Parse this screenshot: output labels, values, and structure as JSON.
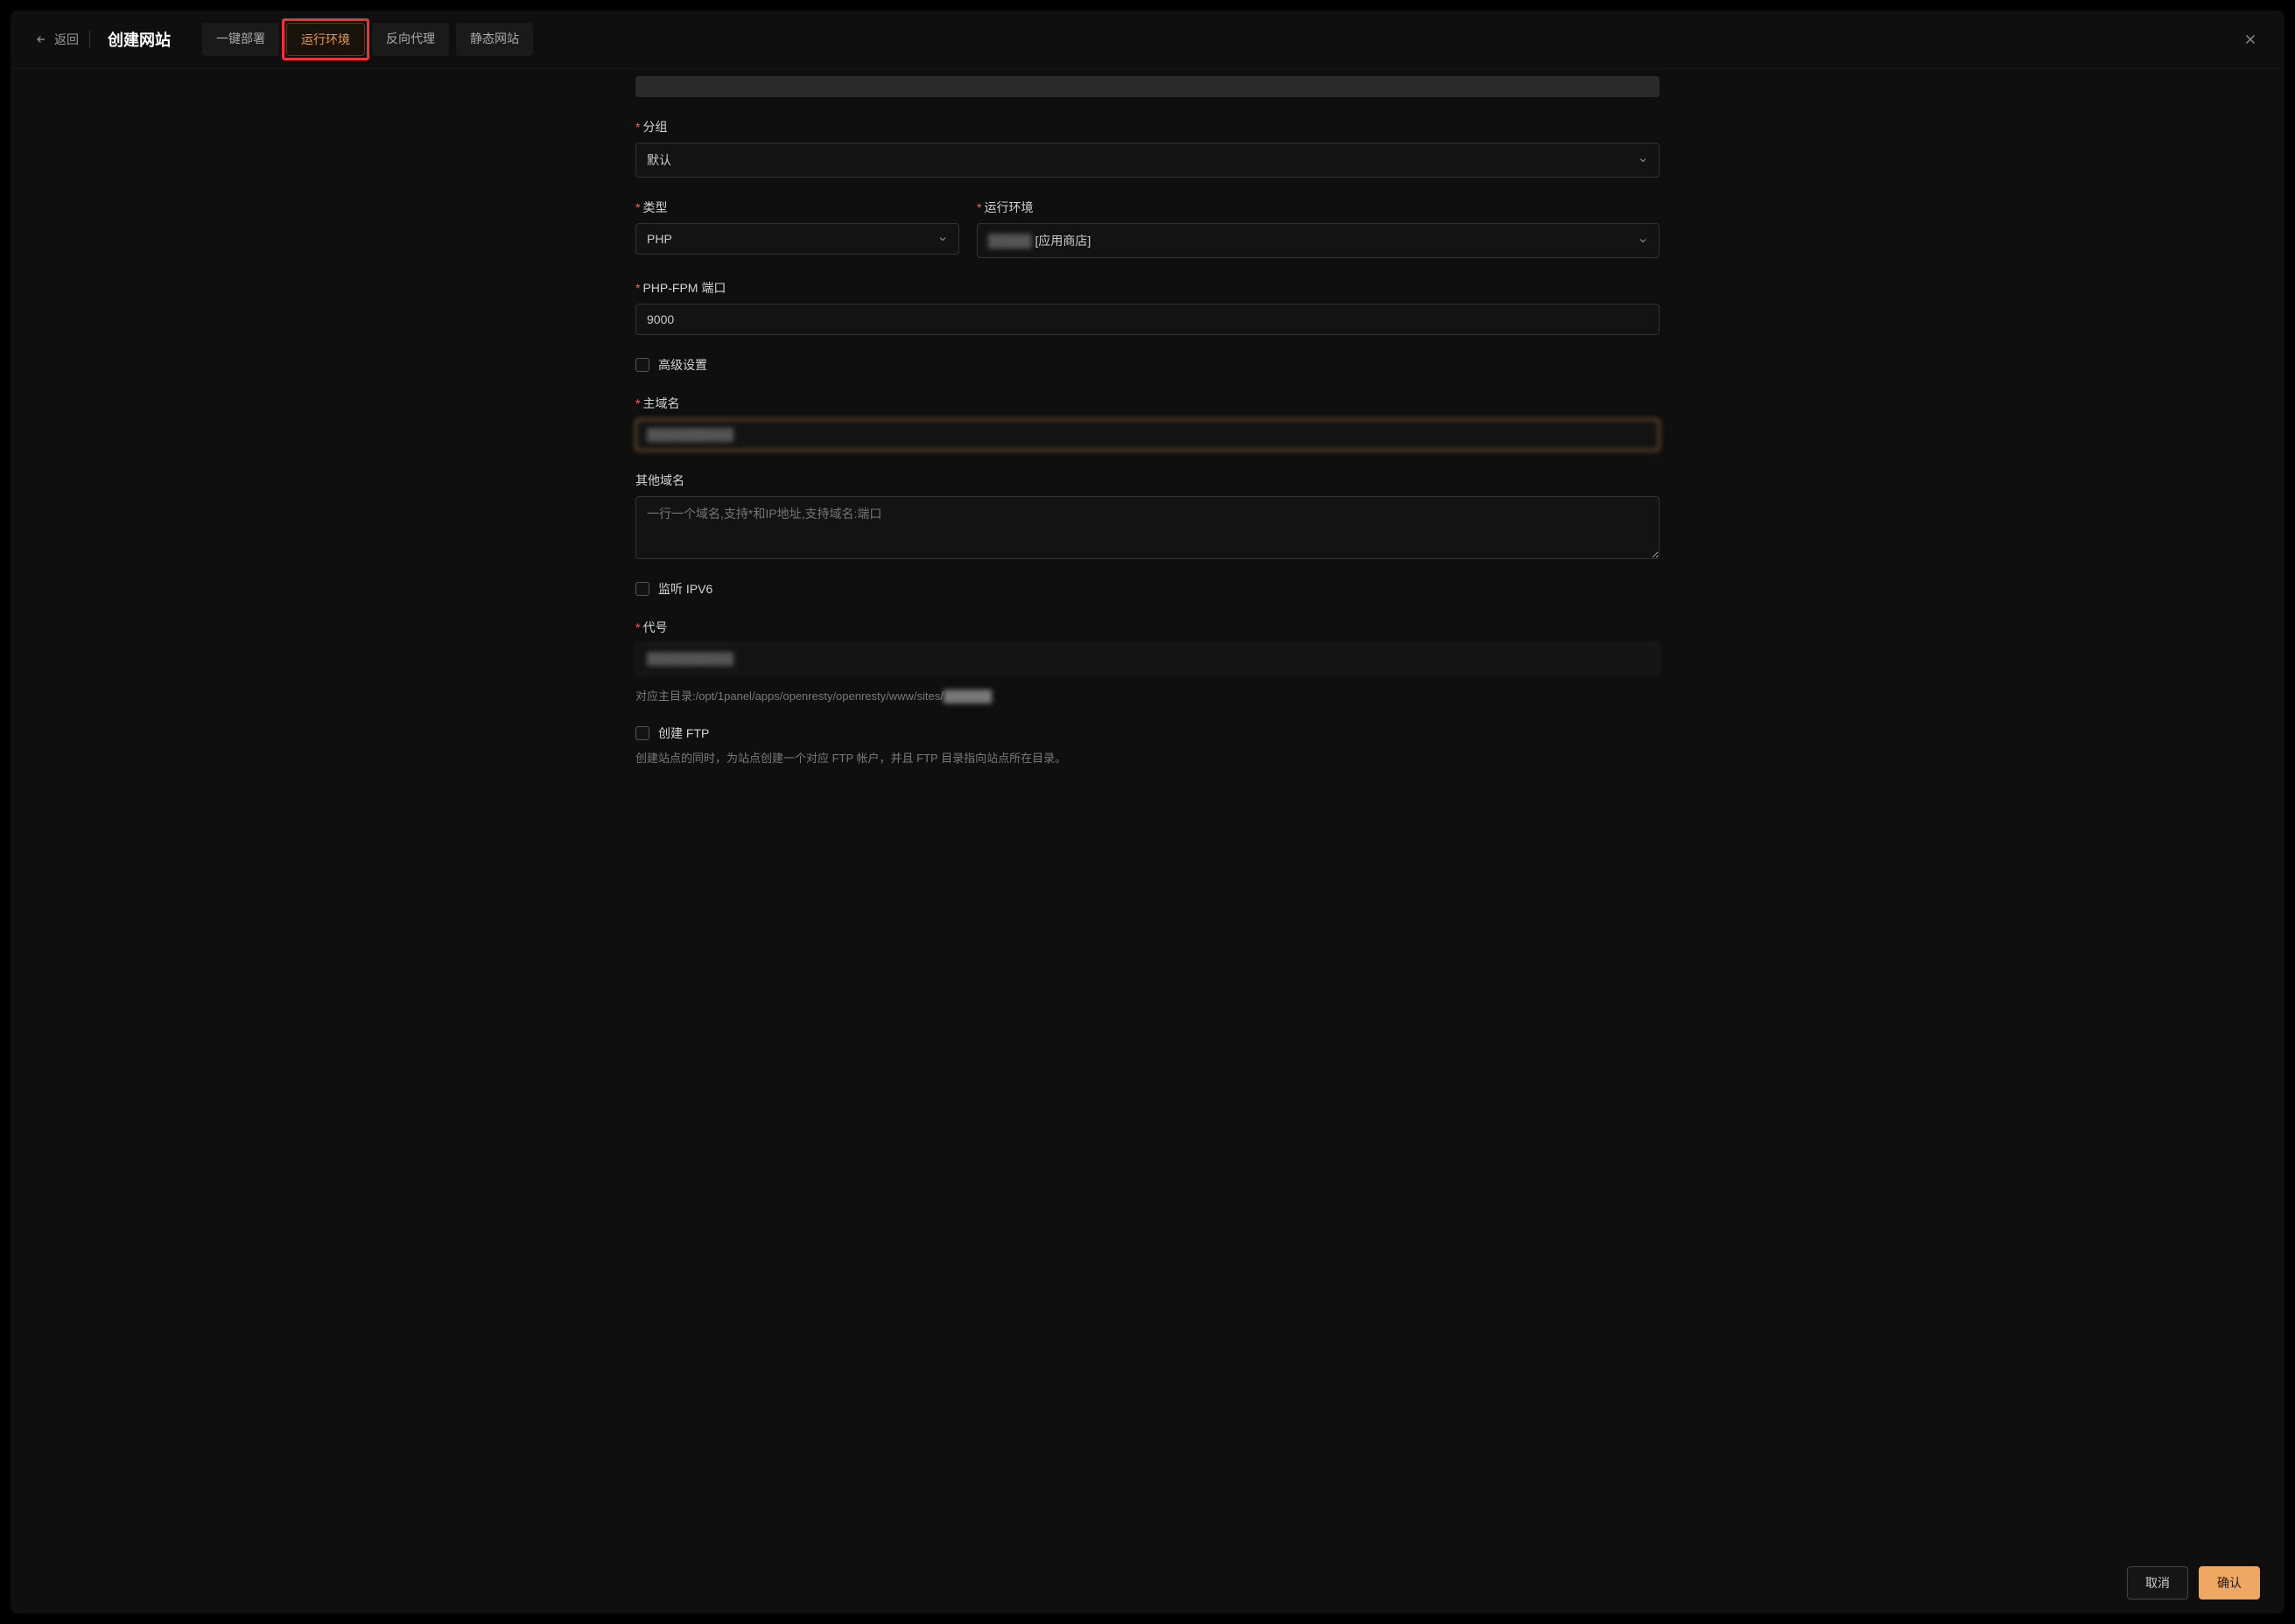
{
  "header": {
    "back_label": "返回",
    "title": "创建网站",
    "tabs": [
      {
        "label": "一键部署"
      },
      {
        "label": "运行环境"
      },
      {
        "label": "反向代理"
      },
      {
        "label": "静态网站"
      }
    ]
  },
  "form": {
    "group": {
      "label": "分组",
      "value": "默认"
    },
    "type": {
      "label": "类型",
      "value": "PHP"
    },
    "runtime": {
      "label": "运行环境",
      "value_obscured": "█████",
      "value_suffix": " [应用商店]"
    },
    "fpm_port": {
      "label": "PHP-FPM 端口",
      "value": "9000"
    },
    "advanced": {
      "label": "高级设置"
    },
    "primary_domain": {
      "label": "主域名",
      "value_obscured": "██████████"
    },
    "other_domains": {
      "label": "其他域名",
      "placeholder": "一行一个域名,支持*和IP地址,支持域名:端口"
    },
    "ipv6": {
      "label": "监听 IPV6"
    },
    "alias": {
      "label": "代号",
      "value_obscured": "██████████",
      "help_prefix": "对应主目录:/opt/1panel/apps/openresty/openresty/www/sites/",
      "help_obscured": "██████"
    },
    "ftp": {
      "label": "创建 FTP",
      "help": "创建站点的同时，为站点创建一个对应 FTP 帐户，并且 FTP 目录指向站点所在目录。"
    }
  },
  "footer": {
    "cancel": "取消",
    "confirm": "确认"
  }
}
